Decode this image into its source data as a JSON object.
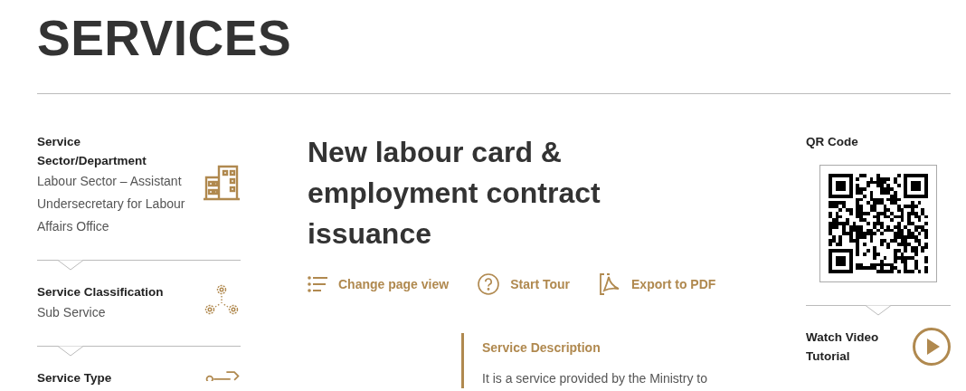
{
  "page_title": "SERVICES",
  "details": [
    {
      "label": "Service Sector/Department",
      "value": "Labour Sector – Assistant Undersecretary for Labour Affairs Office"
    },
    {
      "label": "Service Classification",
      "value": "Sub Service"
    },
    {
      "label": "Service Type"
    }
  ],
  "service": {
    "title": "New labour card & employment contract issuance",
    "actions": [
      {
        "label": "Change page view"
      },
      {
        "label": "Start Tour"
      },
      {
        "label": "Export to PDF"
      }
    ],
    "description": {
      "heading": "Service Description",
      "text": "It is a service provided by the Ministry to"
    }
  },
  "qr": {
    "label": "QR Code"
  },
  "video": {
    "label": "Watch Video Tutorial"
  }
}
